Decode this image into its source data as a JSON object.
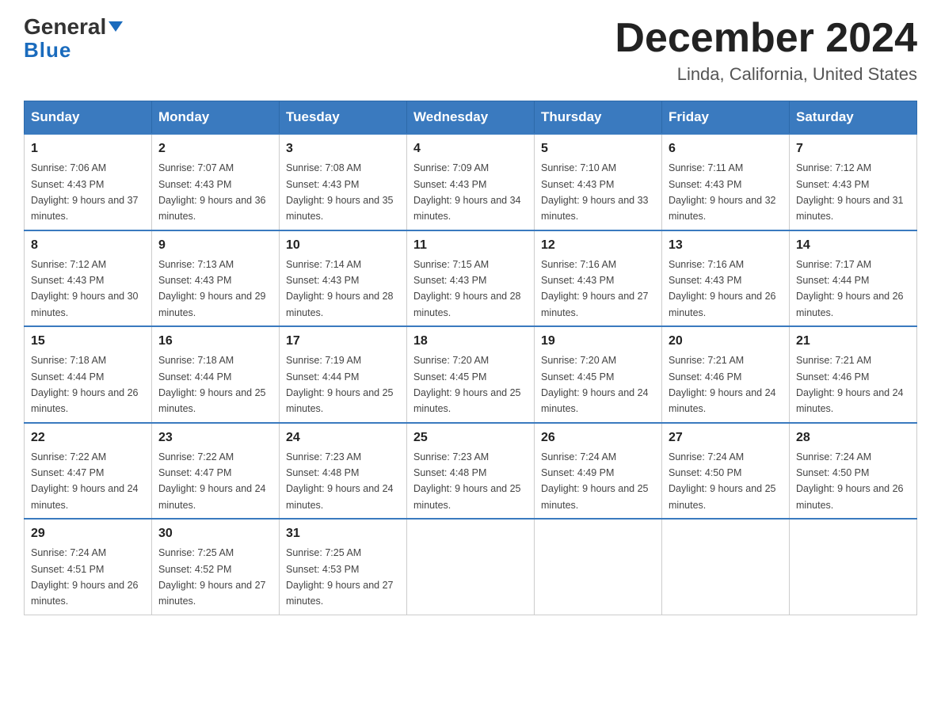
{
  "header": {
    "logo_line1": "General",
    "logo_line2": "Blue",
    "month": "December 2024",
    "location": "Linda, California, United States"
  },
  "weekdays": [
    "Sunday",
    "Monday",
    "Tuesday",
    "Wednesday",
    "Thursday",
    "Friday",
    "Saturday"
  ],
  "weeks": [
    [
      {
        "day": "1",
        "sunrise": "7:06 AM",
        "sunset": "4:43 PM",
        "daylight": "9 hours and 37 minutes."
      },
      {
        "day": "2",
        "sunrise": "7:07 AM",
        "sunset": "4:43 PM",
        "daylight": "9 hours and 36 minutes."
      },
      {
        "day": "3",
        "sunrise": "7:08 AM",
        "sunset": "4:43 PM",
        "daylight": "9 hours and 35 minutes."
      },
      {
        "day": "4",
        "sunrise": "7:09 AM",
        "sunset": "4:43 PM",
        "daylight": "9 hours and 34 minutes."
      },
      {
        "day": "5",
        "sunrise": "7:10 AM",
        "sunset": "4:43 PM",
        "daylight": "9 hours and 33 minutes."
      },
      {
        "day": "6",
        "sunrise": "7:11 AM",
        "sunset": "4:43 PM",
        "daylight": "9 hours and 32 minutes."
      },
      {
        "day": "7",
        "sunrise": "7:12 AM",
        "sunset": "4:43 PM",
        "daylight": "9 hours and 31 minutes."
      }
    ],
    [
      {
        "day": "8",
        "sunrise": "7:12 AM",
        "sunset": "4:43 PM",
        "daylight": "9 hours and 30 minutes."
      },
      {
        "day": "9",
        "sunrise": "7:13 AM",
        "sunset": "4:43 PM",
        "daylight": "9 hours and 29 minutes."
      },
      {
        "day": "10",
        "sunrise": "7:14 AM",
        "sunset": "4:43 PM",
        "daylight": "9 hours and 28 minutes."
      },
      {
        "day": "11",
        "sunrise": "7:15 AM",
        "sunset": "4:43 PM",
        "daylight": "9 hours and 28 minutes."
      },
      {
        "day": "12",
        "sunrise": "7:16 AM",
        "sunset": "4:43 PM",
        "daylight": "9 hours and 27 minutes."
      },
      {
        "day": "13",
        "sunrise": "7:16 AM",
        "sunset": "4:43 PM",
        "daylight": "9 hours and 26 minutes."
      },
      {
        "day": "14",
        "sunrise": "7:17 AM",
        "sunset": "4:44 PM",
        "daylight": "9 hours and 26 minutes."
      }
    ],
    [
      {
        "day": "15",
        "sunrise": "7:18 AM",
        "sunset": "4:44 PM",
        "daylight": "9 hours and 26 minutes."
      },
      {
        "day": "16",
        "sunrise": "7:18 AM",
        "sunset": "4:44 PM",
        "daylight": "9 hours and 25 minutes."
      },
      {
        "day": "17",
        "sunrise": "7:19 AM",
        "sunset": "4:44 PM",
        "daylight": "9 hours and 25 minutes."
      },
      {
        "day": "18",
        "sunrise": "7:20 AM",
        "sunset": "4:45 PM",
        "daylight": "9 hours and 25 minutes."
      },
      {
        "day": "19",
        "sunrise": "7:20 AM",
        "sunset": "4:45 PM",
        "daylight": "9 hours and 24 minutes."
      },
      {
        "day": "20",
        "sunrise": "7:21 AM",
        "sunset": "4:46 PM",
        "daylight": "9 hours and 24 minutes."
      },
      {
        "day": "21",
        "sunrise": "7:21 AM",
        "sunset": "4:46 PM",
        "daylight": "9 hours and 24 minutes."
      }
    ],
    [
      {
        "day": "22",
        "sunrise": "7:22 AM",
        "sunset": "4:47 PM",
        "daylight": "9 hours and 24 minutes."
      },
      {
        "day": "23",
        "sunrise": "7:22 AM",
        "sunset": "4:47 PM",
        "daylight": "9 hours and 24 minutes."
      },
      {
        "day": "24",
        "sunrise": "7:23 AM",
        "sunset": "4:48 PM",
        "daylight": "9 hours and 24 minutes."
      },
      {
        "day": "25",
        "sunrise": "7:23 AM",
        "sunset": "4:48 PM",
        "daylight": "9 hours and 25 minutes."
      },
      {
        "day": "26",
        "sunrise": "7:24 AM",
        "sunset": "4:49 PM",
        "daylight": "9 hours and 25 minutes."
      },
      {
        "day": "27",
        "sunrise": "7:24 AM",
        "sunset": "4:50 PM",
        "daylight": "9 hours and 25 minutes."
      },
      {
        "day": "28",
        "sunrise": "7:24 AM",
        "sunset": "4:50 PM",
        "daylight": "9 hours and 26 minutes."
      }
    ],
    [
      {
        "day": "29",
        "sunrise": "7:24 AM",
        "sunset": "4:51 PM",
        "daylight": "9 hours and 26 minutes."
      },
      {
        "day": "30",
        "sunrise": "7:25 AM",
        "sunset": "4:52 PM",
        "daylight": "9 hours and 27 minutes."
      },
      {
        "day": "31",
        "sunrise": "7:25 AM",
        "sunset": "4:53 PM",
        "daylight": "9 hours and 27 minutes."
      },
      null,
      null,
      null,
      null
    ]
  ],
  "labels": {
    "sunrise_prefix": "Sunrise: ",
    "sunset_prefix": "Sunset: ",
    "daylight_prefix": "Daylight: "
  }
}
